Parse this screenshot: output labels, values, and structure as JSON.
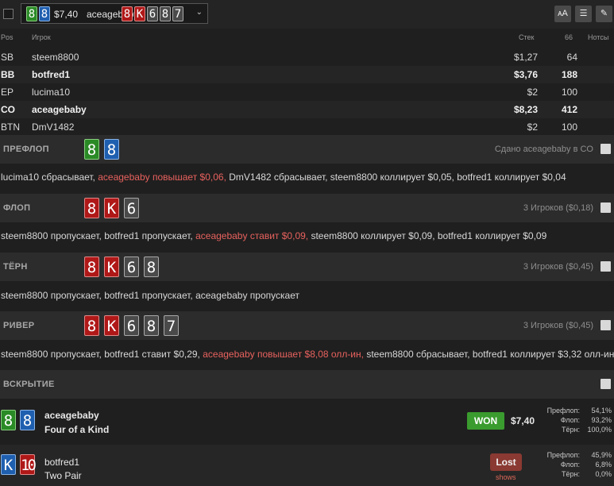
{
  "header": {
    "hole_cards": [
      {
        "rank": "8",
        "suit": "club"
      },
      {
        "rank": "8",
        "suit": "diamond"
      }
    ],
    "amount": "$7,40",
    "player": "aceagebaby",
    "board": [
      {
        "rank": "8",
        "suit": "heart"
      },
      {
        "rank": "K",
        "suit": "heart"
      },
      {
        "rank": "6",
        "suit": "spade"
      },
      {
        "rank": "8",
        "suit": "spade"
      },
      {
        "rank": "7",
        "suit": "spade"
      }
    ],
    "tools": [
      "font-size-icon",
      "list-icon",
      "pencil-icon"
    ],
    "tool_glyphs": [
      "ᴀA",
      "☰",
      "✎"
    ]
  },
  "table": {
    "headers": {
      "pos": "Pos",
      "player": "Игрок",
      "stack": "Стек",
      "bb": "66",
      "notes": "Нотсы"
    },
    "rows": [
      {
        "pos": "SB",
        "name": "steem8800",
        "stack": "$1,27",
        "bb": "64",
        "bold": false
      },
      {
        "pos": "BB",
        "name": "botfred1",
        "stack": "$3,76",
        "bb": "188",
        "bold": true
      },
      {
        "pos": "EP",
        "name": "lucima10",
        "stack": "$2",
        "bb": "100",
        "bold": false
      },
      {
        "pos": "CO",
        "name": "aceagebaby",
        "stack": "$8,23",
        "bb": "412",
        "bold": true
      },
      {
        "pos": "BTN",
        "name": "DmV1482",
        "stack": "$2",
        "bb": "100",
        "bold": false
      }
    ]
  },
  "streets": {
    "preflop": {
      "title": "ПРЕФЛОП",
      "info": "Сдано aceagebaby в CO",
      "cards": [
        {
          "rank": "8",
          "suit": "club"
        },
        {
          "rank": "8",
          "suit": "diamond"
        }
      ],
      "actions": [
        {
          "text": "lucima10 сбрасывает, ",
          "hl": false
        },
        {
          "text": "aceagebaby повышает $0,06,",
          "hl": true
        },
        {
          "text": " DmV1482 сбрасывает, steem8800 коллирует $0,05, botfred1 коллирует $0,04",
          "hl": false
        }
      ]
    },
    "flop": {
      "title": "ФЛОП",
      "info": "3 Игроков ($0,18)",
      "cards": [
        {
          "rank": "8",
          "suit": "heart"
        },
        {
          "rank": "K",
          "suit": "heart"
        },
        {
          "rank": "6",
          "suit": "spade"
        }
      ],
      "actions": [
        {
          "text": "steem8800 пропускает, botfred1 пропускает, ",
          "hl": false
        },
        {
          "text": "aceagebaby ставит $0,09,",
          "hl": true
        },
        {
          "text": " steem8800 коллирует $0,09, botfred1 коллирует $0,09",
          "hl": false
        }
      ]
    },
    "turn": {
      "title": "ТЁРН",
      "info": "3 Игроков ($0,45)",
      "cards": [
        {
          "rank": "8",
          "suit": "heart"
        },
        {
          "rank": "K",
          "suit": "heart"
        },
        {
          "rank": "6",
          "suit": "spade"
        },
        {
          "rank": "8",
          "suit": "spade"
        }
      ],
      "actions": [
        {
          "text": "steem8800 пропускает, botfred1 пропускает, aceagebaby пропускает",
          "hl": false
        }
      ]
    },
    "river": {
      "title": "РИВЕР",
      "info": "3 Игроков ($0,45)",
      "cards": [
        {
          "rank": "8",
          "suit": "heart"
        },
        {
          "rank": "K",
          "suit": "heart"
        },
        {
          "rank": "6",
          "suit": "spade"
        },
        {
          "rank": "8",
          "suit": "spade"
        },
        {
          "rank": "7",
          "suit": "spade"
        }
      ],
      "actions": [
        {
          "text": "steem8800 пропускает, botfred1 ставит $0,29, ",
          "hl": false
        },
        {
          "text": "aceagebaby повышает $8,08 олл-ин,",
          "hl": true
        },
        {
          "text": " steem8800 сбрасывает, botfred1 коллирует $3,32 олл-ин",
          "hl": false
        }
      ]
    }
  },
  "showdown": {
    "title": "ВСКРЫТИЕ",
    "players": [
      {
        "cards": [
          {
            "rank": "8",
            "suit": "club"
          },
          {
            "rank": "8",
            "suit": "diamond"
          }
        ],
        "name": "aceagebaby",
        "hand": "Four of a Kind",
        "result": "WON",
        "amount": "$7,40",
        "equity": [
          {
            "label": "Префлоп:",
            "value": "54,1%"
          },
          {
            "label": "Флоп:",
            "value": "93,2%"
          },
          {
            "label": "Тёрн:",
            "value": "100,0%"
          }
        ]
      },
      {
        "cards": [
          {
            "rank": "K",
            "suit": "diamond"
          },
          {
            "rank": "10",
            "suit": "heart"
          }
        ],
        "name": "botfred1",
        "hand": "Two Pair",
        "result": "Lost",
        "sub": "shows",
        "equity": [
          {
            "label": "Префлоп:",
            "value": "45,9%"
          },
          {
            "label": "Флоп:",
            "value": "6,8%"
          },
          {
            "label": "Тёрн:",
            "value": "0,0%"
          }
        ]
      }
    ]
  },
  "colors": {
    "highlight": "#e8625e",
    "won": "#3a9b2e",
    "lost": "#8a3a32",
    "club": "#2a8a25",
    "diamond": "#1f5fb0",
    "heart": "#b01818",
    "spade": "#4a4a4a"
  }
}
